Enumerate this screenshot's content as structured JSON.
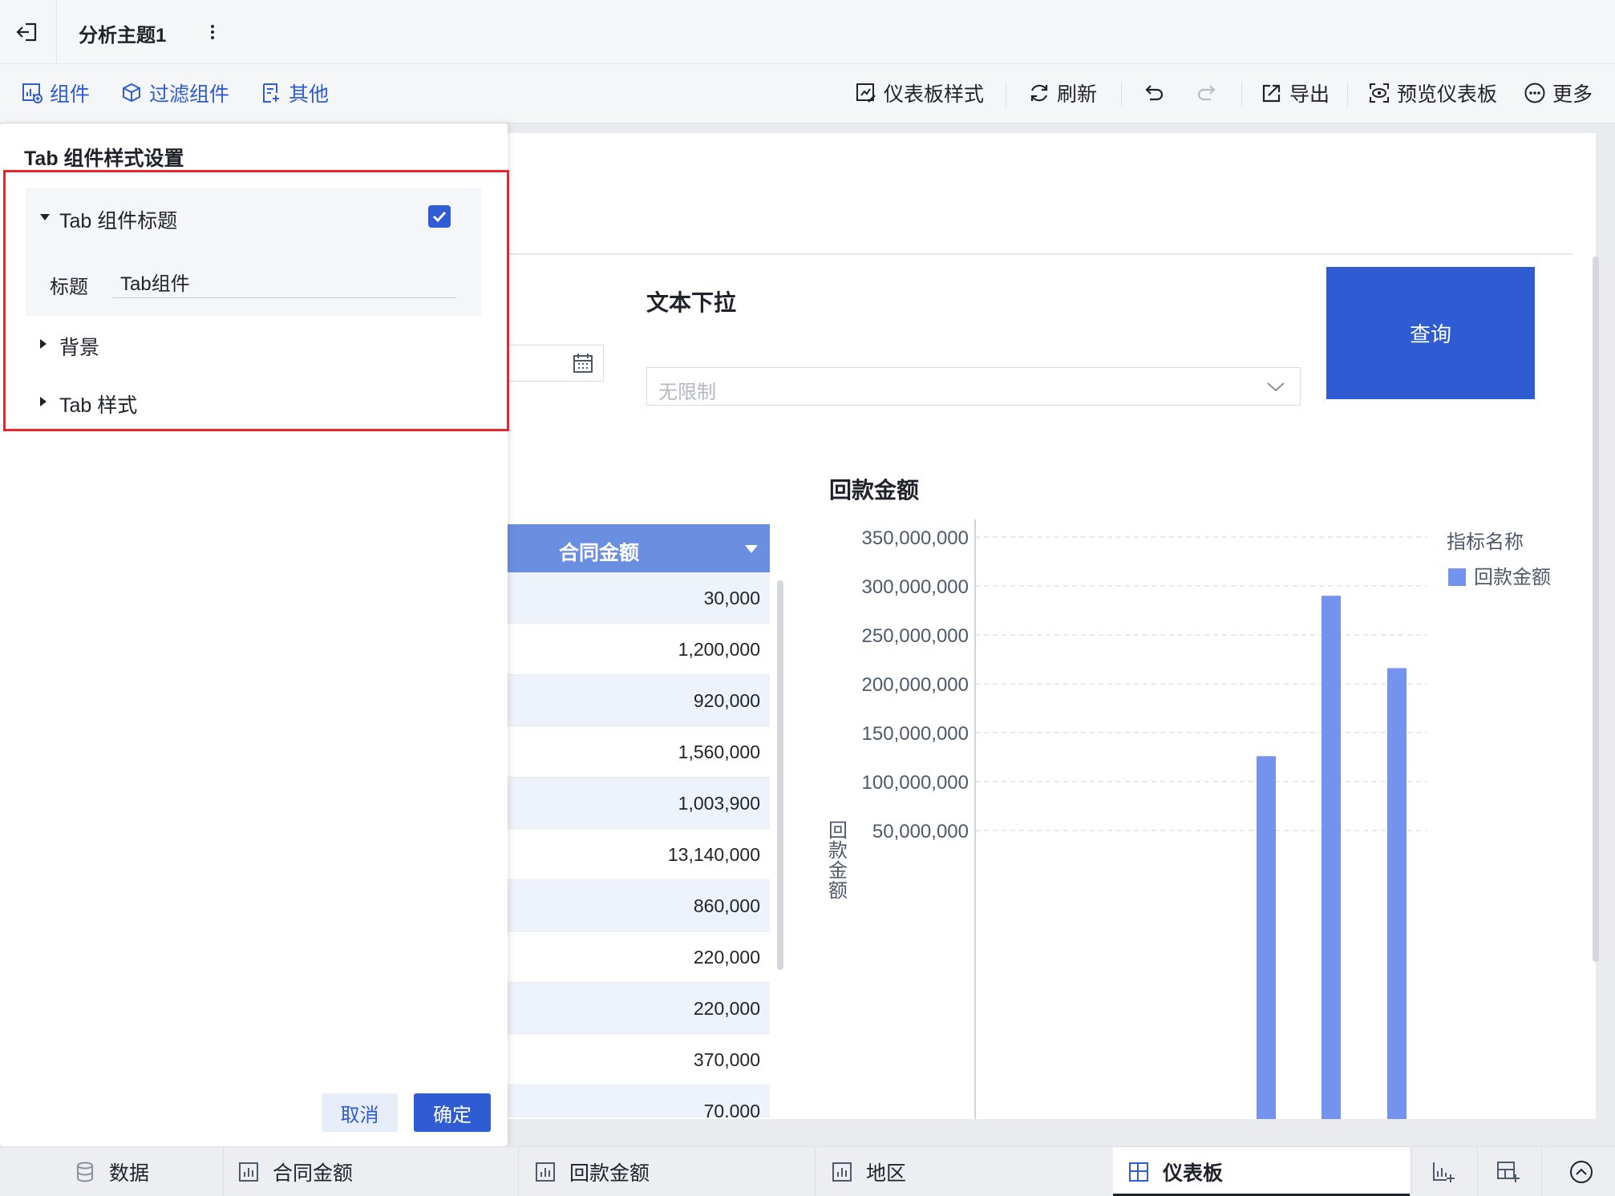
{
  "header": {
    "title": "分析主题1"
  },
  "toolbar": {
    "left": [
      {
        "label": "组件",
        "icon": "add-chart-icon"
      },
      {
        "label": "过滤组件",
        "icon": "filter-cube-icon"
      },
      {
        "label": "其他",
        "icon": "add-doc-icon"
      }
    ],
    "right": [
      {
        "label": "仪表板样式",
        "icon": "style-icon"
      },
      {
        "label": "刷新",
        "icon": "refresh-icon"
      },
      {
        "label": "",
        "icon": "undo-icon"
      },
      {
        "label": "",
        "icon": "redo-icon"
      },
      {
        "label": "导出",
        "icon": "export-icon"
      },
      {
        "label": "预览仪表板",
        "icon": "preview-icon"
      },
      {
        "label": "更多",
        "icon": "more-icon"
      }
    ]
  },
  "panel": {
    "title": "Tab 组件样式设置",
    "sections": [
      {
        "label": "Tab 组件标题",
        "expanded": true,
        "checked": true
      },
      {
        "label": "背景",
        "expanded": false
      },
      {
        "label": "Tab 样式",
        "expanded": false
      }
    ],
    "title_field_label": "标题",
    "title_field_value": "Tab组件",
    "cancel_label": "取消",
    "ok_label": "确定"
  },
  "filters": {
    "label": "文本下拉",
    "select_placeholder": "无限制",
    "query_label": "查询"
  },
  "table": {
    "header": "合同金额",
    "rows": [
      "30,000",
      "1,200,000",
      "920,000",
      "1,560,000",
      "1,003,900",
      "13,140,000",
      "860,000",
      "220,000",
      "220,000",
      "370,000",
      "70,000"
    ]
  },
  "chart_data": {
    "type": "bar",
    "title": "回款金额",
    "ylabel": "回款金额",
    "legend_title": "指标名称",
    "legend_position": "top-right",
    "series": [
      {
        "name": "回款金额",
        "color": "#7393ee",
        "values": [
          126000000,
          290000000,
          216000000
        ]
      }
    ],
    "yticks": [
      50000000,
      100000000,
      150000000,
      200000000,
      250000000,
      300000000,
      350000000
    ],
    "ytick_labels": [
      "50,000,000",
      "100,000,000",
      "150,000,000",
      "200,000,000",
      "250,000,000",
      "300,000,000",
      "350,000,000"
    ],
    "ylim": [
      0,
      350000000
    ],
    "grid": true
  },
  "bottom_tabs": [
    {
      "label": "数据",
      "icon": "database-icon"
    },
    {
      "label": "合同金额",
      "icon": "bar-chart-icon"
    },
    {
      "label": "回款金额",
      "icon": "bar-chart-icon"
    },
    {
      "label": "地区",
      "icon": "bar-chart-icon"
    },
    {
      "label": "仪表板",
      "icon": "dashboard-icon",
      "active": true
    }
  ],
  "colors": {
    "accent": "#2f5bd3",
    "bar": "#7393ee",
    "table_header": "#6b8fe0",
    "highlight": "#e8262b"
  }
}
